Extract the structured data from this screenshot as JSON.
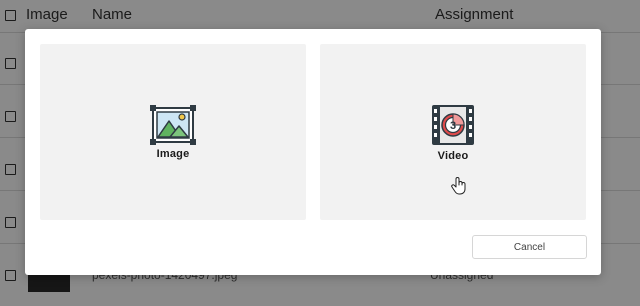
{
  "table": {
    "headers": {
      "image": "Image",
      "name": "Name",
      "assignment": "Assignment"
    },
    "last_row": {
      "name": "pexels-photo-1420497.jpeg",
      "assignment": "Unassigned"
    }
  },
  "modal": {
    "options": [
      {
        "label": "Image",
        "icon": "image-icon"
      },
      {
        "label": "Video",
        "icon": "video-icon"
      }
    ],
    "cancel_label": "Cancel"
  },
  "colors": {
    "card_bg": "#f2f2f2",
    "icon_dark": "#2f3b43",
    "icon_red": "#e04b4b",
    "icon_green": "#5fb35f",
    "icon_sky": "#cde6f4"
  }
}
